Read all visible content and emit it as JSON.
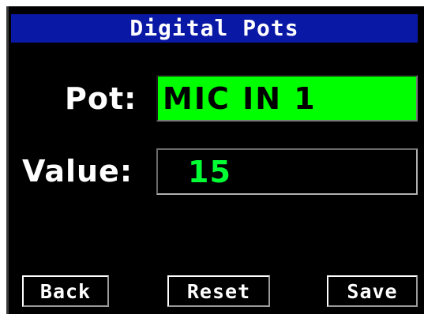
{
  "title": "Digital Pots",
  "form": {
    "pot_label": "Pot:",
    "pot_value": "MIC IN 1",
    "value_label": "Value:",
    "value_value": "15"
  },
  "buttons": {
    "back": "Back",
    "reset": "Reset",
    "save": "Save"
  },
  "colors": {
    "title_bar": "#0a18a6",
    "screen_bg": "#000000",
    "selected_field": "#00ff00",
    "value_text": "#00ff33",
    "text": "#ffffff"
  }
}
